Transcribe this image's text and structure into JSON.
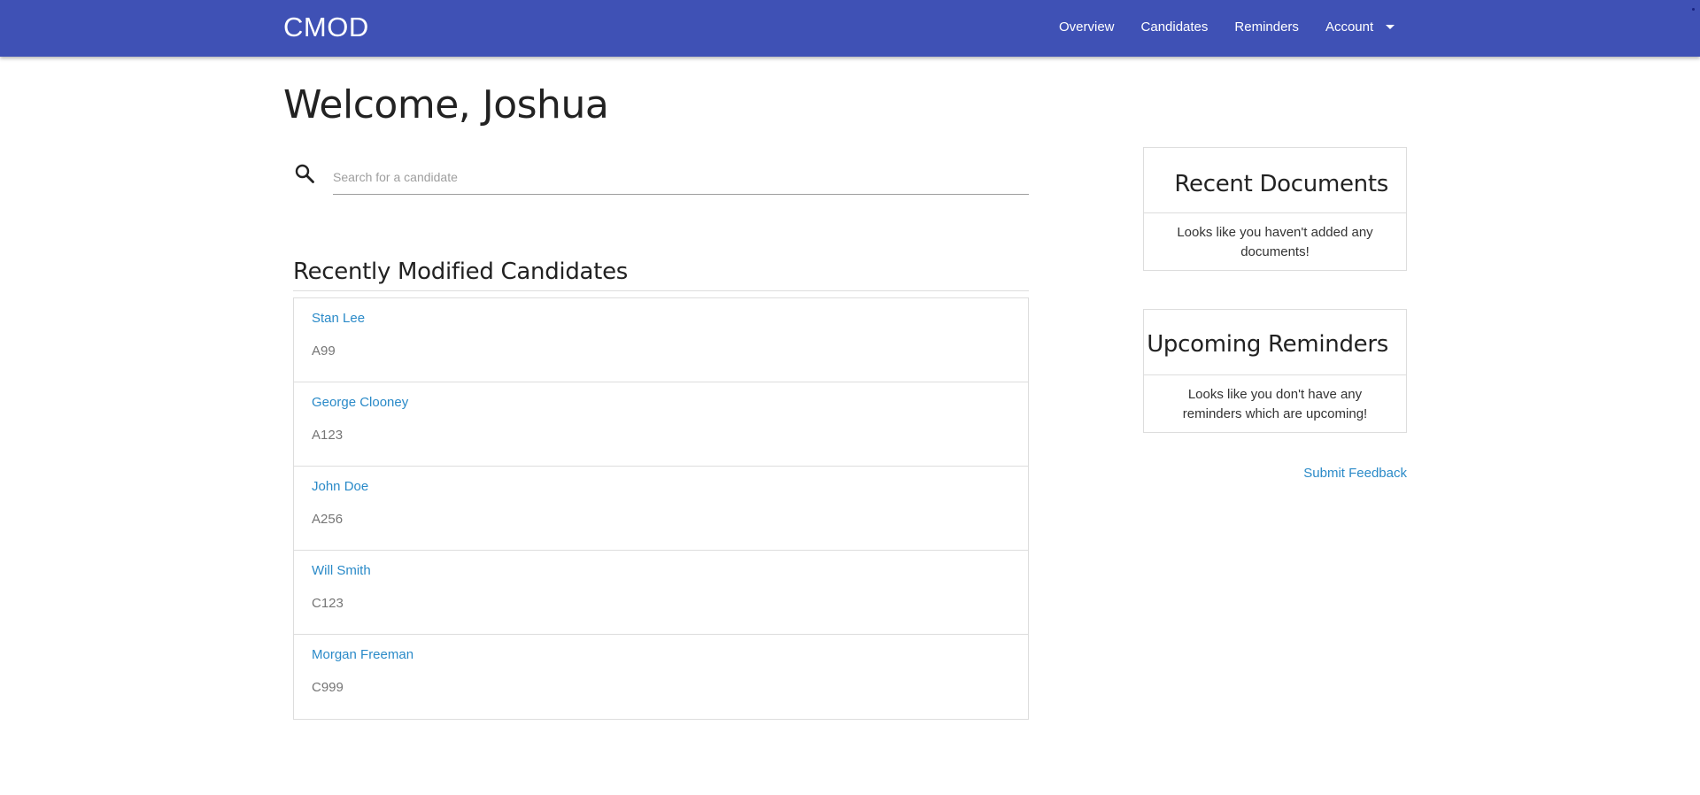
{
  "navbar": {
    "brand": "CMOD",
    "links": [
      "Overview",
      "Candidates",
      "Reminders",
      "Account"
    ]
  },
  "welcome": "Welcome, Joshua",
  "search": {
    "placeholder": "Search for a candidate",
    "value": "",
    "icon": "search-icon"
  },
  "recent": {
    "title": "Recently Modified Candidates",
    "candidates": [
      {
        "name": "Stan Lee",
        "code": "A99"
      },
      {
        "name": "George Clooney",
        "code": "A123"
      },
      {
        "name": "John Doe",
        "code": "A256"
      },
      {
        "name": "Will Smith",
        "code": "C123"
      },
      {
        "name": "Morgan Freeman",
        "code": "C999"
      }
    ]
  },
  "documents": {
    "title": "Recent Documents",
    "empty_text": "Looks like you haven't added any documents!"
  },
  "reminders": {
    "title": "Upcoming Reminders",
    "empty_text": "Looks like you don't have any reminders which are upcoming!"
  },
  "feedback_label": "Submit Feedback",
  "colors": {
    "navbar": "#3f51b5",
    "link": "#2a8ac8",
    "code_text": "#757575",
    "border": "#dddddd"
  }
}
